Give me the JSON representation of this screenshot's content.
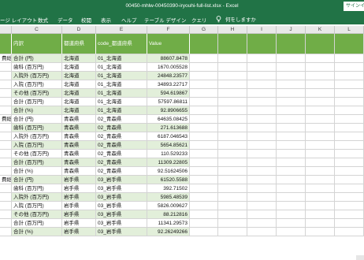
{
  "window": {
    "title": "00450-mhlw-00450390-iryouhi-full-list.xlsx  -  Excel",
    "signin_label": "サインイ"
  },
  "ribbon": {
    "tabs": [
      "ージ レイアウト",
      "数式",
      "データ",
      "校閲",
      "表示",
      "ヘルプ",
      "テーブル デザイン",
      "クエリ"
    ],
    "active_tab": "クエリ",
    "tell_me": "何をしますか",
    "tell_me_icon": "lightbulb-icon"
  },
  "sheet": {
    "column_letters": [
      "C",
      "D",
      "E",
      "F",
      "G",
      "H",
      "I",
      "J",
      "K",
      "L"
    ],
    "headers": [
      "内訳",
      "都道府県",
      "code_都道府県",
      "Value"
    ],
    "rows": [
      {
        "b": "費総",
        "c": "合計 (円)",
        "d": "北海道",
        "e": "01_北海道",
        "f": "88607.8478"
      },
      {
        "b": "",
        "c": "歯科 (百万円)",
        "d": "北海道",
        "e": "01_北海道",
        "f": "1670.005528"
      },
      {
        "b": "",
        "c": "入院外 (百万円)",
        "d": "北海道",
        "e": "01_北海道",
        "f": "24848.23577"
      },
      {
        "b": "",
        "c": "入院 (百万円)",
        "d": "北海道",
        "e": "01_北海道",
        "f": "34893.22717"
      },
      {
        "b": "",
        "c": "その他 (百万円)",
        "d": "北海道",
        "e": "01_北海道",
        "f": "594.619867"
      },
      {
        "b": "",
        "c": "合計 (百万円)",
        "d": "北海道",
        "e": "01_北海道",
        "f": "57597.86811"
      },
      {
        "b": "",
        "c": "合計 (%)",
        "d": "北海道",
        "e": "01_北海道",
        "f": "92.8906655"
      },
      {
        "b": "費総",
        "c": "合計 (円)",
        "d": "青森県",
        "e": "02_青森県",
        "f": "64635.08425"
      },
      {
        "b": "",
        "c": "歯科 (百万円)",
        "d": "青森県",
        "e": "02_青森県",
        "f": "271.613688"
      },
      {
        "b": "",
        "c": "入院外 (百万円)",
        "d": "青森県",
        "e": "02_青森県",
        "f": "6187.046543"
      },
      {
        "b": "",
        "c": "入院 (百万円)",
        "d": "青森県",
        "e": "02_青森県",
        "f": "5654.85621"
      },
      {
        "b": "",
        "c": "その他 (百万円)",
        "d": "青森県",
        "e": "02_青森県",
        "f": "110.529233"
      },
      {
        "b": "",
        "c": "合計 (百万円)",
        "d": "青森県",
        "e": "02_青森県",
        "f": "11309.22805"
      },
      {
        "b": "",
        "c": "合計 (%)",
        "d": "青森県",
        "e": "02_青森県",
        "f": "92.51624506"
      },
      {
        "b": "費総",
        "c": "合計 (円)",
        "d": "岩手県",
        "e": "03_岩手県",
        "f": "61520.5588"
      },
      {
        "b": "",
        "c": "歯科 (百万円)",
        "d": "岩手県",
        "e": "03_岩手県",
        "f": "392.71502"
      },
      {
        "b": "",
        "c": "入院外 (百万円)",
        "d": "岩手県",
        "e": "03_岩手県",
        "f": "5985.48539"
      },
      {
        "b": "",
        "c": "入院 (百万円)",
        "d": "岩手県",
        "e": "03_岩手県",
        "f": "5826.009627"
      },
      {
        "b": "",
        "c": "その他 (百万円)",
        "d": "岩手県",
        "e": "03_岩手県",
        "f": "88.212816"
      },
      {
        "b": "",
        "c": "合計 (百万円)",
        "d": "岩手県",
        "e": "03_岩手県",
        "f": "11341.29573"
      },
      {
        "b": "",
        "c": "合計 (%)",
        "d": "岩手県",
        "e": "03_岩手県",
        "f": "92.26249266"
      }
    ]
  },
  "colors": {
    "excel_green": "#217346",
    "table_header": "#70ad47",
    "band_row": "#e2efda"
  }
}
